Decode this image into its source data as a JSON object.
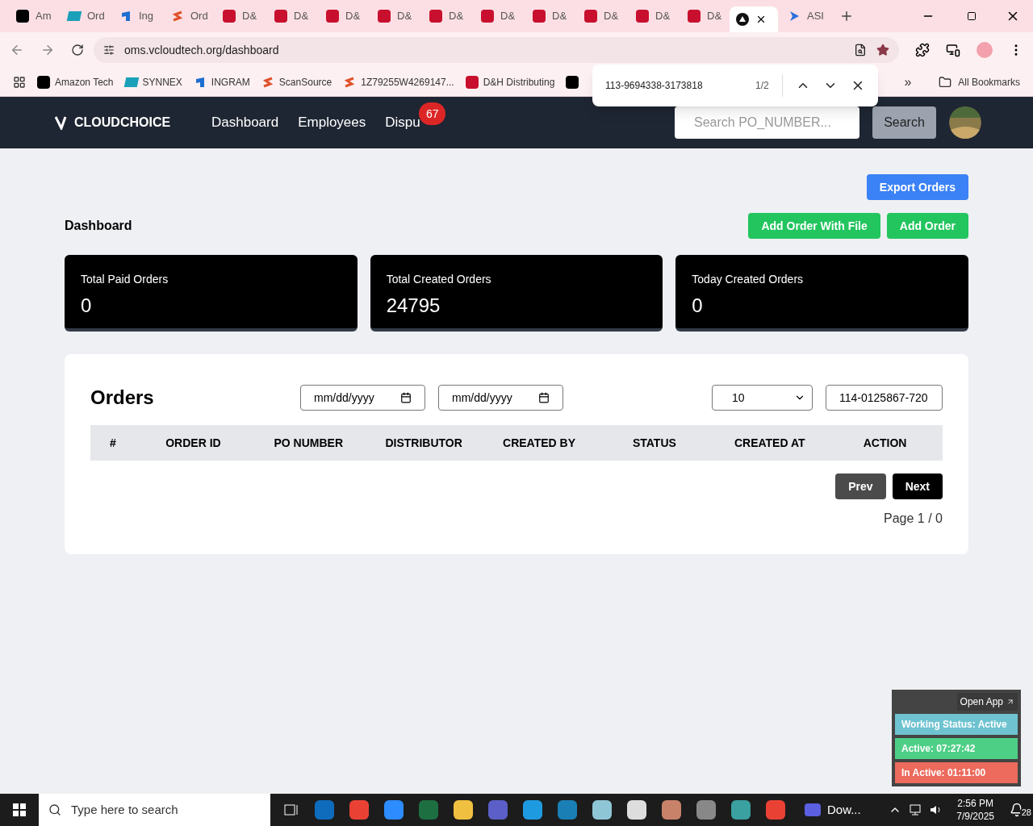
{
  "browser": {
    "tabs": [
      {
        "title": "Am",
        "kind": "amazon",
        "selected": false
      },
      {
        "title": "Ord",
        "kind": "ec",
        "selected": false
      },
      {
        "title": "Ing",
        "kind": "ingram",
        "selected": false
      },
      {
        "title": "Ord",
        "kind": "scansource",
        "selected": false
      },
      {
        "title": "D&",
        "kind": "dh",
        "selected": false
      },
      {
        "title": "D&",
        "kind": "dh",
        "selected": false
      },
      {
        "title": "D&",
        "kind": "dh",
        "selected": false
      },
      {
        "title": "D&",
        "kind": "dh",
        "selected": false
      },
      {
        "title": "D&",
        "kind": "dh",
        "selected": false
      },
      {
        "title": "D&",
        "kind": "dh",
        "selected": false
      },
      {
        "title": "D&",
        "kind": "dh",
        "selected": false
      },
      {
        "title": "D&",
        "kind": "dh",
        "selected": false
      },
      {
        "title": "D&",
        "kind": "dh",
        "selected": false
      },
      {
        "title": "D&",
        "kind": "dh",
        "selected": false
      },
      {
        "kind": "circle",
        "selected": true
      },
      {
        "title": "ASI",
        "kind": "arrow",
        "selected": false
      }
    ],
    "address": "oms.vcloudtech.org/dashboard",
    "bookmarks": [
      {
        "title": "Amazon Tech",
        "kind": "amazon"
      },
      {
        "title": "SYNNEX",
        "kind": "ec"
      },
      {
        "title": "INGRAM",
        "kind": "ingram"
      },
      {
        "title": "ScanSource",
        "kind": "scansource"
      },
      {
        "title": "1Z79255W4269147...",
        "kind": "scansource"
      },
      {
        "title": "D&H Distributing",
        "kind": "dh"
      },
      {
        "kind": "amazon"
      }
    ],
    "overflow": "»",
    "all_bookmarks": "All Bookmarks"
  },
  "find_bar": {
    "query": "113-9694338-3173818",
    "count": "1/2"
  },
  "nav": {
    "logo": "CLOUDCHOICE",
    "items": [
      {
        "label": "Dashboard"
      },
      {
        "label": "Employees"
      },
      {
        "label": "Dispu",
        "badge": "67"
      }
    ],
    "search_placeholder": "Search PO_NUMBER...",
    "search_button": "Search"
  },
  "page": {
    "title": "Dashboard",
    "export_button": "Export Orders",
    "add_file_button": "Add Order With File",
    "add_button": "Add Order",
    "stats": [
      {
        "label": "Total Paid Orders",
        "value": "0"
      },
      {
        "label": "Total Created Orders",
        "value": "24795"
      },
      {
        "label": "Today Created Orders",
        "value": "0"
      }
    ],
    "orders": {
      "title": "Orders",
      "date_from_placeholder": "mm/dd/yyyy",
      "date_to_placeholder": "mm/dd/yyyy",
      "page_size": "10",
      "search_value": "114-0125867-720",
      "columns": [
        "#",
        "ORDER ID",
        "PO NUMBER",
        "DISTRIBUTOR",
        "CREATED BY",
        "STATUS",
        "CREATED AT",
        "ACTION"
      ],
      "prev": "Prev",
      "next": "Next",
      "page_info": "Page 1 / 0"
    }
  },
  "widget": {
    "open_app": "Open App",
    "rows": [
      {
        "text": "Working Status: Active",
        "color": "#6fc3d0"
      },
      {
        "text": "Active: 07:27:42",
        "color": "#4ecf86"
      },
      {
        "text": "In Active: 01:11:00",
        "color": "#ec6b5d"
      }
    ]
  },
  "taskbar": {
    "search_placeholder": "Type here to search",
    "app_label": "Dow...",
    "time": "2:56 PM",
    "date": "7/9/2025",
    "notifications": "28"
  }
}
